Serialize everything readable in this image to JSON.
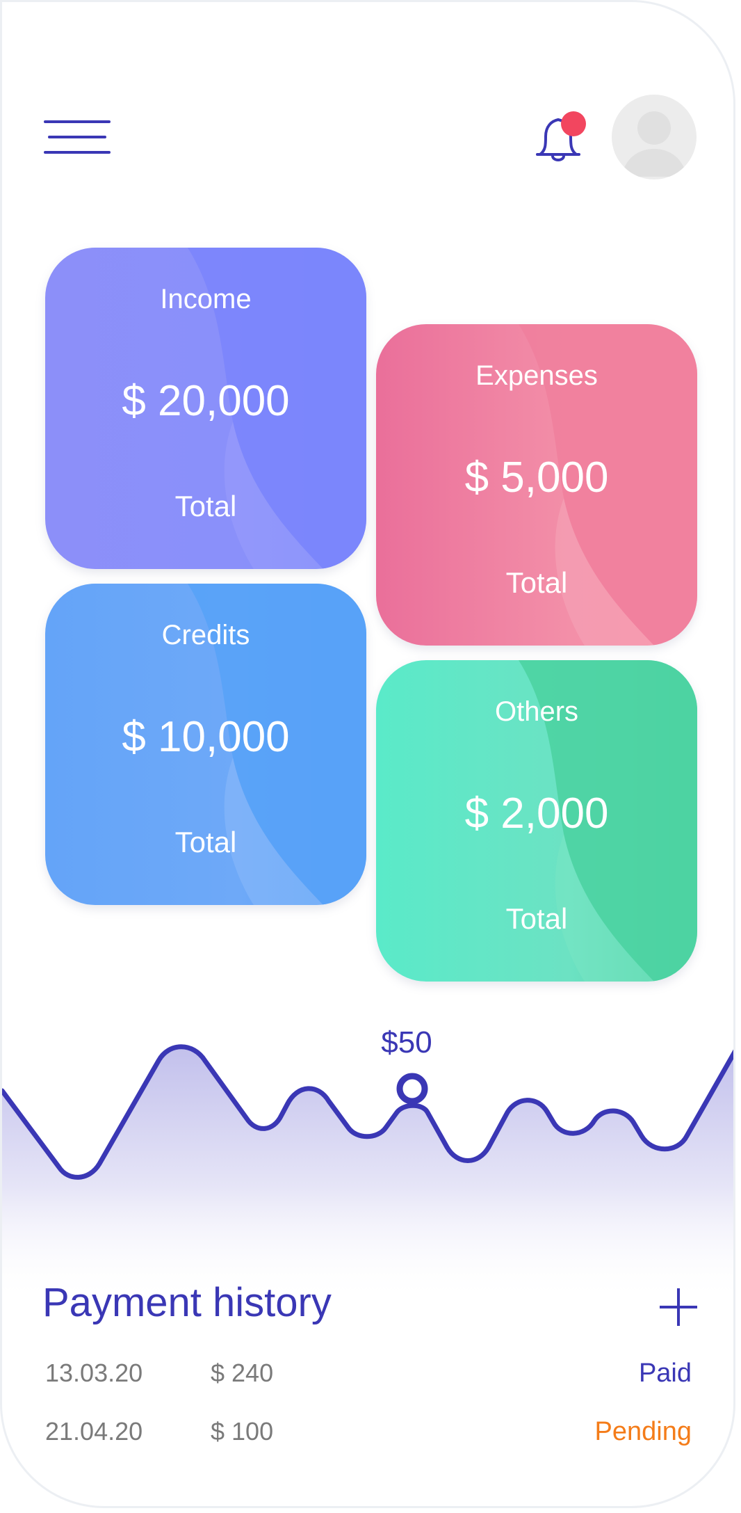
{
  "header": {
    "menu_icon": "hamburger-menu-icon",
    "notification_icon": "bell-icon",
    "notification_dot_color": "#f2465f",
    "avatar_icon": "user-avatar-icon"
  },
  "cards": {
    "income": {
      "title": "Income",
      "amount": "$ 20,000",
      "sub": "Total",
      "color": "#8a8ff9"
    },
    "expenses": {
      "title": "Expenses",
      "amount": "$ 5,000",
      "sub": "Total",
      "color": "#f08aa5"
    },
    "credits": {
      "title": "Credits",
      "amount": "$ 10,000",
      "sub": "Total",
      "color": "#68a7f8"
    },
    "others": {
      "title": "Others",
      "amount": "$ 2,000",
      "sub": "Total",
      "color": "#5fe3c2"
    }
  },
  "chart": {
    "selected_value": "$50",
    "line_color": "#3a37b5",
    "fill_color": "#c5c4ec"
  },
  "payment_history": {
    "title": "Payment history",
    "add_icon": "plus-icon",
    "rows": [
      {
        "date": "13.03.20",
        "amount": "$ 240",
        "status": "Paid"
      },
      {
        "date": "21.04.20",
        "amount": "$ 100",
        "status": "Pending"
      }
    ],
    "status_colors": {
      "Paid": "#3a37b5",
      "Pending": "#f47c19"
    }
  }
}
